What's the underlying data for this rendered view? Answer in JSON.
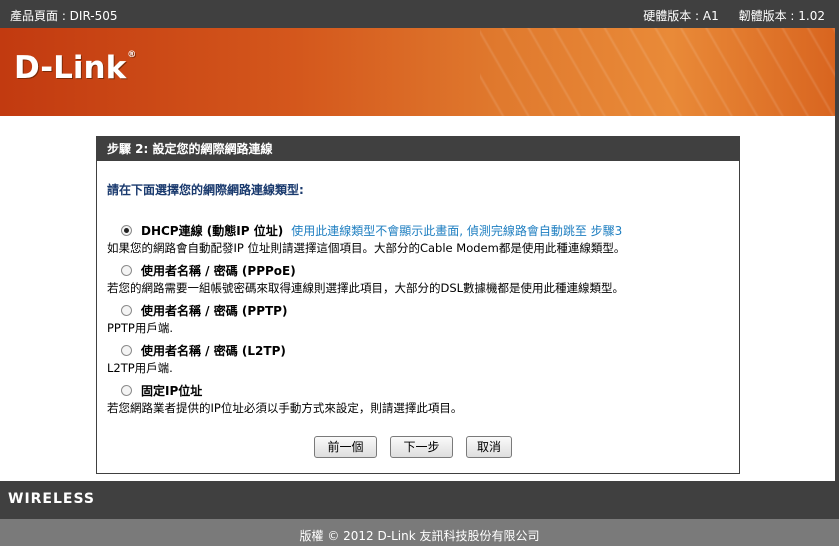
{
  "topbar": {
    "product_label": "產品頁面 : DIR-505",
    "hardware_version": "硬體版本 : A1",
    "firmware_version": "韌體版本 : 1.02"
  },
  "brand": {
    "logo_text": "D-Link",
    "logo_mark": "®"
  },
  "panel": {
    "title": "步驟 2: 設定您的網際網路連線",
    "prompt": "請在下面選擇您的網際網路連線類型:",
    "options": [
      {
        "label": "DHCP連線 (動態IP 位址)",
        "note": "使用此連線類型不會顯示此畫面, 偵測完線路會自動跳至 步驟3",
        "desc": "如果您的網路會自動配發IP 位址則請選擇這個項目。大部分的Cable Modem都是使用此種連線類型。",
        "selected": true
      },
      {
        "label": "使用者名稱 / 密碼 (PPPoE)",
        "note": "",
        "desc": "若您的網路需要一組帳號密碼來取得連線則選擇此項目，大部分的DSL數據機都是使用此種連線類型。",
        "selected": false
      },
      {
        "label": "使用者名稱 / 密碼 (PPTP)",
        "note": "",
        "desc": "PPTP用戶端.",
        "selected": false
      },
      {
        "label": "使用者名稱 / 密碼 (L2TP)",
        "note": "",
        "desc": "L2TP用戶端.",
        "selected": false
      },
      {
        "label": "固定IP位址",
        "note": "",
        "desc": "若您網路業者提供的IP位址必須以手動方式來設定，則請選擇此項目。",
        "selected": false
      }
    ],
    "buttons": {
      "prev": "前一個",
      "next": "下一步",
      "cancel": "取消"
    }
  },
  "footer": {
    "wireless_label": "WIRELESS",
    "copyright": "版權 © 2012 D-Link 友訊科技股份有限公司"
  },
  "colors": {
    "header_bar": "#404040",
    "banner_orange": "#e07a2e",
    "prompt_blue": "#1a3a6e",
    "note_blue": "#1f7fc1"
  }
}
